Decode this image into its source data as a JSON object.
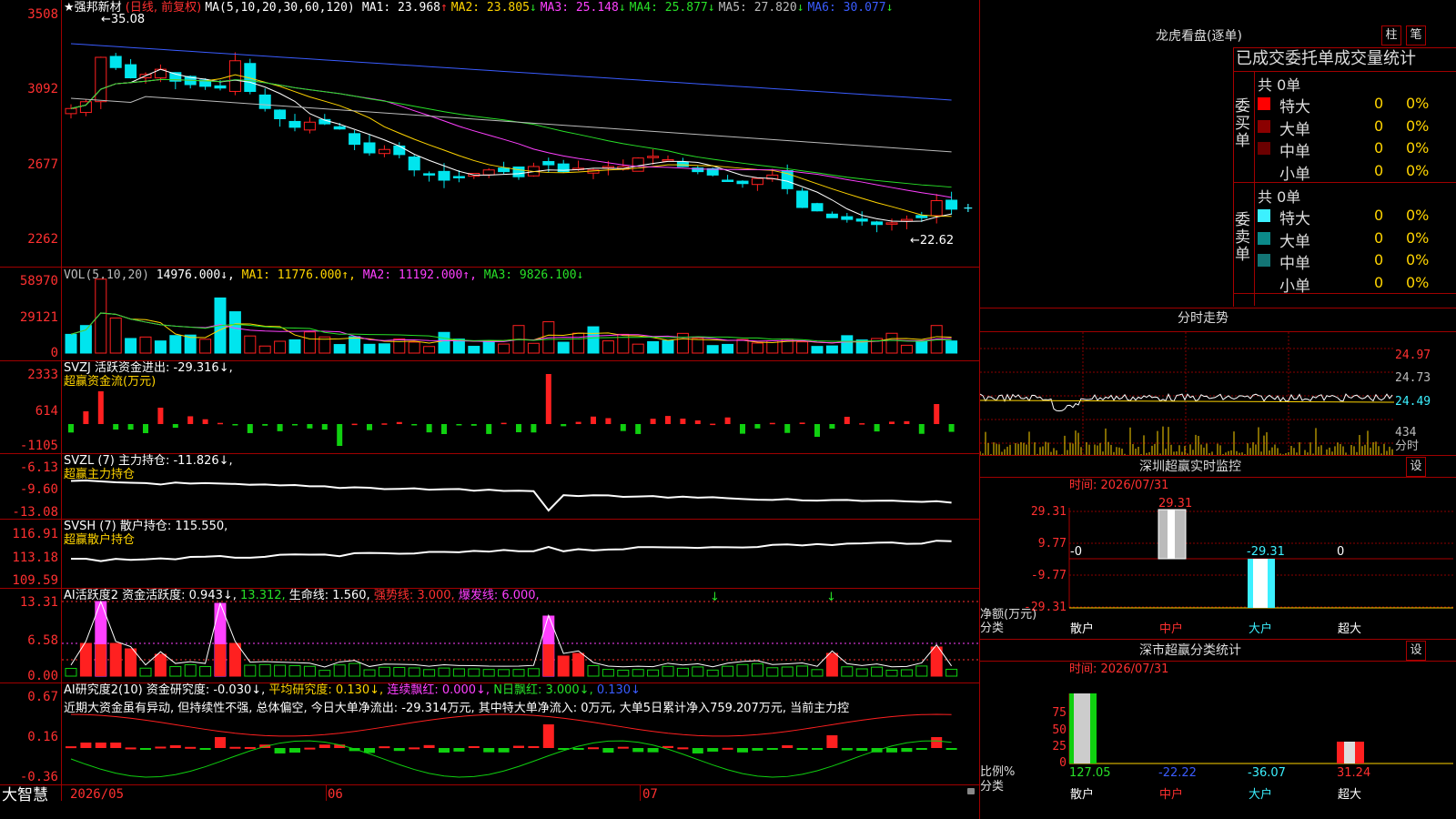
{
  "main": {
    "price_axis": [
      "3508",
      "3092",
      "2677",
      "2262"
    ],
    "stock_name": "★强邦新材",
    "period": "(日线, 前复权)",
    "ma_prefix": "MA(5,10,20,30,60,120)",
    "ma": [
      {
        "label": "MA1: 23.968",
        "arrow": "↑",
        "color": "#ffffff"
      },
      {
        "label": "MA2: 23.805",
        "arrow": "↓",
        "color": "#ffd400"
      },
      {
        "label": "MA3: 25.148",
        "arrow": "↓",
        "color": "#ff40ff"
      },
      {
        "label": "MA4: 25.877",
        "arrow": "↓",
        "color": "#28e028"
      },
      {
        "label": "MA5: 27.820",
        "arrow": "↓",
        "color": "#bbbbbb"
      },
      {
        "label": "MA6: 30.077",
        "arrow": "↓",
        "color": "#3a5cff"
      }
    ],
    "high_marker": "←35.08",
    "low_marker": "←22.62"
  },
  "vol": {
    "axis": [
      "58970",
      "29121",
      "0"
    ],
    "title": "VOL(5,10,20)",
    "value": "14976.000↓,",
    "ma1": "MA1: 11776.000↑,",
    "ma2": "MA2: 11192.000↑,",
    "ma3": "MA3: 9826.100↓"
  },
  "svzj": {
    "axis": [
      "2333",
      "614",
      "-1105"
    ],
    "title": "SVZJ  活跃资金进出: -29.316↓,",
    "subtitle": "超赢资金流(万元)"
  },
  "svzl": {
    "axis": [
      "-6.13",
      "-9.60",
      "-13.08"
    ],
    "title": "SVZL (7) 主力持仓: -11.826↓,",
    "subtitle": "超赢主力持仓"
  },
  "svsh": {
    "axis": [
      "116.91",
      "113.18",
      "109.59"
    ],
    "title": "SVSH (7) 散户持仓: 115.550,",
    "subtitle": "超赢散户持仓"
  },
  "ai1": {
    "axis": [
      "13.31",
      "6.58",
      "0.00"
    ],
    "t1": "AI活跃度2 资金活跃度: 0.943↓,",
    "t2": "13.312,",
    "t3": "生命线: 1.560,",
    "t4": "强势线: 3.000,",
    "t5": "爆发线: 6.000,"
  },
  "ai2": {
    "axis": [
      "0.67",
      "0.16",
      "-0.36"
    ],
    "t1": "AI研究度2(10) 资金研究度: -0.030↓,",
    "t2": "平均研究度: 0.130↓,",
    "t3": "连续飘红: 0.000↓,",
    "t4": "N日飘红: 3.000↓,",
    "t5": "0.130↓",
    "comment": "近期大资金虽有异动, 但持续性不强, 总体偏空, 今日大单净流出: -29.314万元, 其中特大单净流入: 0万元, 大单5日累计净入759.207万元, 当前主力控"
  },
  "bottom": {
    "brand": "大智慧",
    "dates": [
      "2026/05",
      "06",
      "07"
    ]
  },
  "right": {
    "lhb_title": "龙虎看盘(逐单)",
    "btn_bar": "柱",
    "btn_pen": "笔",
    "header": "已成交委托单成交量统计",
    "buy_label": "委买单",
    "sell_label": "委卖单",
    "buy_total": "共 0单",
    "sell_total": "共 0单",
    "buy_rows": [
      {
        "name": "特大",
        "count": "0",
        "pct": "0%",
        "color": "#ff0000"
      },
      {
        "name": "大单",
        "count": "0",
        "pct": "0%",
        "color": "#8b0000"
      },
      {
        "name": "中单",
        "count": "0",
        "pct": "0%",
        "color": "#6b0000"
      },
      {
        "name": "小单",
        "count": "0",
        "pct": "0%",
        "color": "#000000"
      }
    ],
    "sell_rows": [
      {
        "name": "特大",
        "count": "0",
        "pct": "0%",
        "color": "#3cf0ff"
      },
      {
        "name": "大单",
        "count": "0",
        "pct": "0%",
        "color": "#0b8a8a"
      },
      {
        "name": "中单",
        "count": "0",
        "pct": "0%",
        "color": "#137575"
      },
      {
        "name": "小单",
        "count": "0",
        "pct": "0%",
        "color": "#000000"
      }
    ],
    "intraday_title": "分时走势",
    "intraday_axis": [
      "24.97",
      "24.73",
      "24.49"
    ],
    "intraday_vol": "434",
    "intraday_unit": "分时",
    "monitor_title": "深圳超赢实时监控",
    "settings": "设",
    "time_label": "时间: 2026/07/31",
    "monitor_axis": [
      "29.31",
      "9.77",
      "-9.77",
      "-29.31"
    ],
    "monitor_top_value": "29.31",
    "monitor_values": [
      "-0",
      "-29.31",
      "0"
    ],
    "monitor_unit": "净额(万元)",
    "monitor_cat": "分类",
    "monitor_categories": [
      "散户",
      "中户",
      "大户",
      "超大"
    ],
    "class_title": "深市超赢分类统计",
    "class_time": "时间: 2026/07/31",
    "class_axis": [
      "75",
      "50",
      "25",
      "0"
    ],
    "class_unit": "比例%",
    "class_cat": "分类",
    "class_values": [
      "127.05",
      "-22.22",
      "-36.07",
      "31.24"
    ],
    "class_categories": [
      "散户",
      "中户",
      "大户",
      "超大"
    ]
  }
}
